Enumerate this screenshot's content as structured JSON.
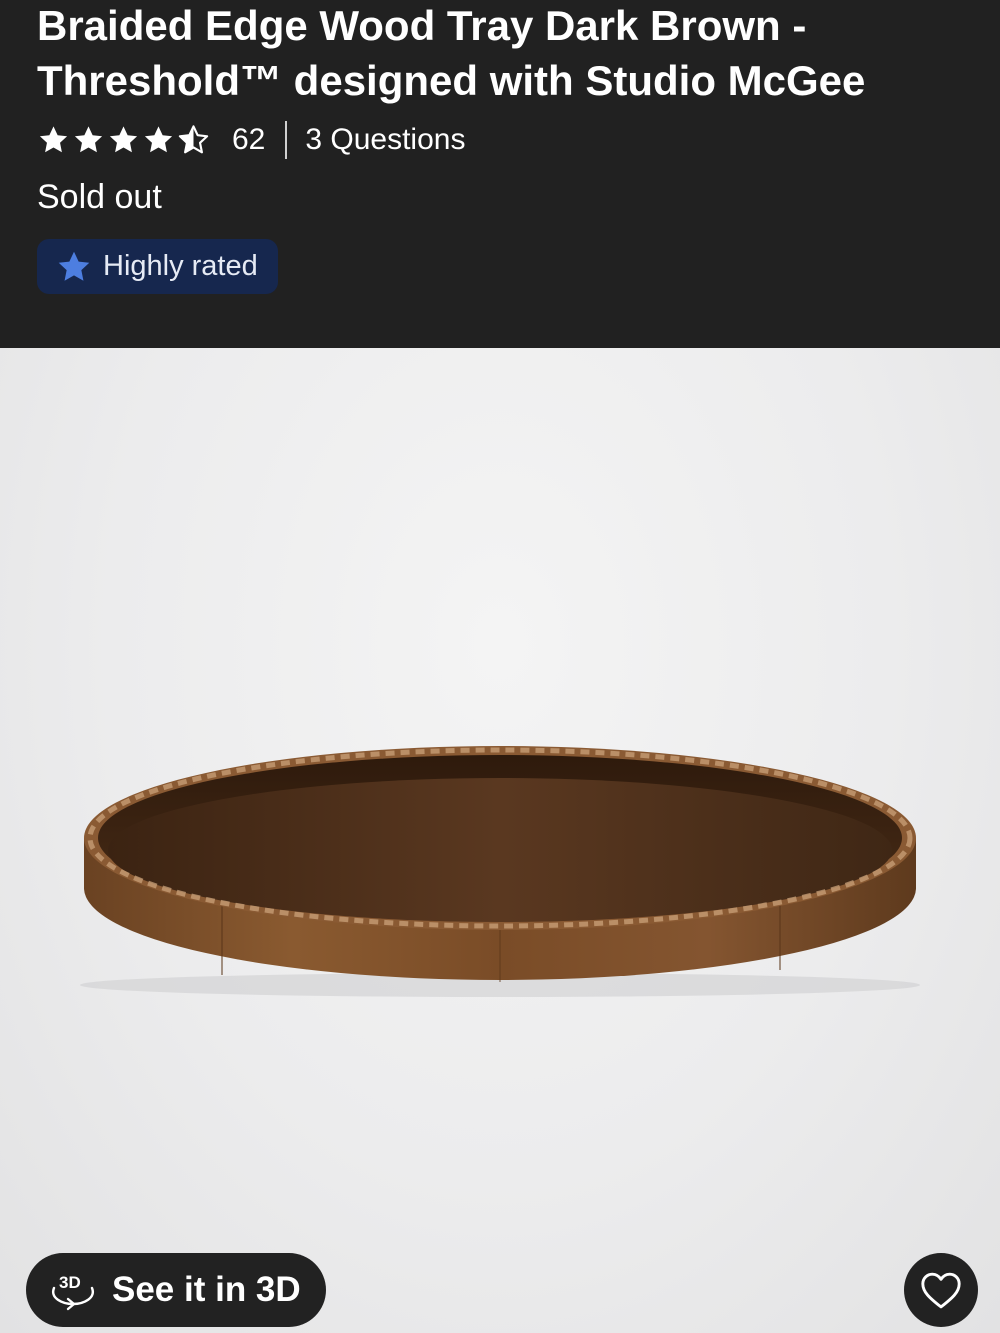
{
  "product": {
    "title": "Braided Edge Wood Tray Dark Brown - Threshold™ designed with Studio McGee",
    "rating": 4.5,
    "rating_max": 5,
    "review_count": "62",
    "questions": "3 Questions",
    "stock_status": "Sold out",
    "badge": "Highly rated"
  },
  "actions": {
    "view_3d_label": "See it in 3D",
    "view_3d_icon": "3d-rotate-icon",
    "favorite_icon": "heart-icon"
  },
  "colors": {
    "header_bg": "#212121",
    "badge_bg": "#16274e",
    "badge_star": "#4d7ee0",
    "button_bg": "#222222"
  }
}
